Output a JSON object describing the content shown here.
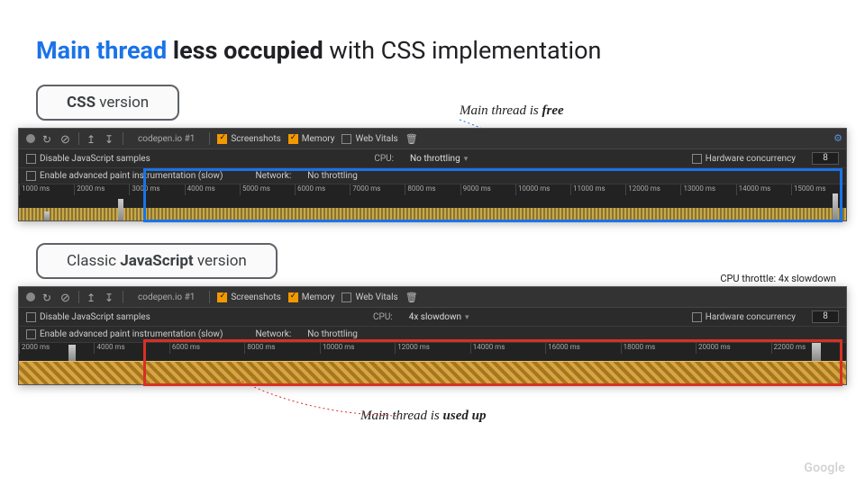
{
  "title": {
    "span1": "Main thread",
    "span2": "less occupied",
    "span3": "with CSS implementation"
  },
  "panel1": {
    "pill_prefix": "",
    "pill_bold": "CSS",
    "pill_suffix": " version",
    "throttle_note": "CPU throttle: 4x slowdown",
    "annotation_prefix": "Main thread is ",
    "annotation_bold": "free",
    "tab_name": "codepen.io #1",
    "chk_screenshots": "Screenshots",
    "chk_memory": "Memory",
    "chk_webvitals": "Web Vitals",
    "opt_disable_js": "Disable JavaScript samples",
    "opt_cpu_lbl": "CPU:",
    "opt_cpu_val": "No throttling",
    "opt_hw_lbl": "Hardware concurrency",
    "opt_hw_val": "8",
    "opt_paint": "Enable advanced paint instrumentation (slow)",
    "opt_net_lbl": "Network:",
    "opt_net_val": "No throttling",
    "ticks": [
      "1000 ms",
      "2000 ms",
      "3000 ms",
      "4000 ms",
      "5000 ms",
      "6000 ms",
      "7000 ms",
      "8000 ms",
      "9000 ms",
      "10000 ms",
      "11000 ms",
      "12000 ms",
      "13000 ms",
      "14000 ms",
      "15000 ms"
    ]
  },
  "panel2": {
    "pill_prefix": "Classic ",
    "pill_bold": "JavaScript",
    "pill_suffix": " version",
    "throttle_note": "CPU throttle: 4x slowdown",
    "annotation_prefix": "Main thread is ",
    "annotation_bold": "used up",
    "tab_name": "codepen.io #1",
    "chk_screenshots": "Screenshots",
    "chk_memory": "Memory",
    "chk_webvitals": "Web Vitals",
    "opt_disable_js": "Disable JavaScript samples",
    "opt_cpu_lbl": "CPU:",
    "opt_cpu_val": "4x slowdown",
    "opt_hw_lbl": "Hardware concurrency",
    "opt_hw_val": "8",
    "opt_paint": "Enable advanced paint instrumentation (slow)",
    "opt_net_lbl": "Network:",
    "opt_net_val": "No throttling",
    "ticks": [
      "2000 ms",
      "4000 ms",
      "6000 ms",
      "8000 ms",
      "10000 ms",
      "12000 ms",
      "14000 ms",
      "16000 ms",
      "18000 ms",
      "20000 ms",
      "22000 ms"
    ]
  },
  "watermark": "Google"
}
